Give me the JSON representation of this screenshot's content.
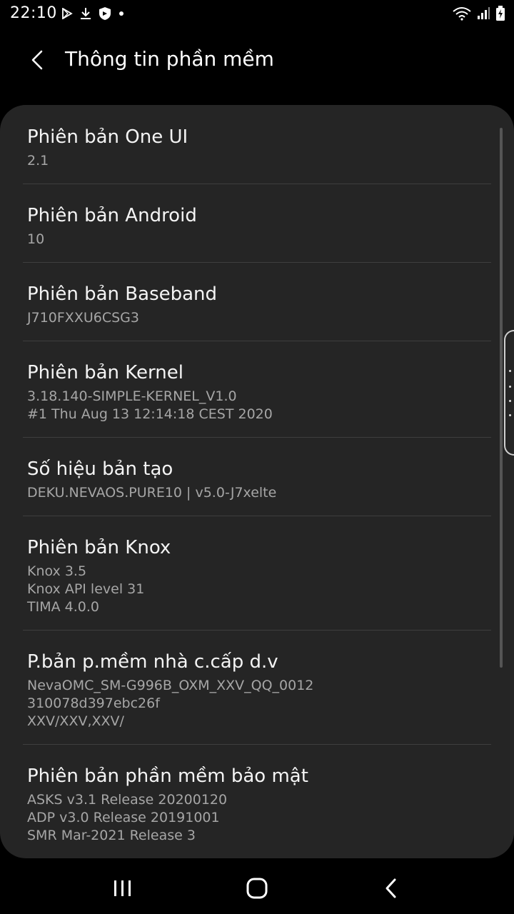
{
  "status_bar": {
    "time": "22:10",
    "left_icons": [
      "play-store-icon",
      "download-icon",
      "shield-icon",
      "dot-icon"
    ],
    "right_icons": [
      "wifi-icon",
      "signal-icon",
      "battery-charging-icon"
    ]
  },
  "header": {
    "title": "Thông tin phần mềm"
  },
  "items": [
    {
      "title": "Phiên bản One UI",
      "values": [
        "2.1"
      ]
    },
    {
      "title": "Phiên bản Android",
      "values": [
        "10"
      ]
    },
    {
      "title": "Phiên bản Baseband",
      "values": [
        "J710FXXU6CSG3"
      ]
    },
    {
      "title": "Phiên bản Kernel",
      "values": [
        "3.18.140-SIMPLE-KERNEL_V1.0",
        "#1 Thu Aug 13 12:14:18 CEST 2020"
      ]
    },
    {
      "title": "Số hiệu bản tạo",
      "values": [
        "DEKU.NEVAOS.PURE10 | v5.0-J7xelte"
      ]
    },
    {
      "title": "Phiên bản Knox",
      "values": [
        "Knox 3.5",
        "Knox API level 31",
        "TIMA 4.0.0"
      ]
    },
    {
      "title": "P.bản p.mềm nhà c.cấp d.v",
      "values": [
        "NevaOMC_SM-G996B_OXM_XXV_QQ_0012",
        "310078d397ebc26f",
        "XXV/XXV,XXV/"
      ]
    },
    {
      "title": "Phiên bản phần mềm bảo mật",
      "values": [
        "ASKS v3.1 Release 20200120",
        "ADP v3.0 Release 20191001",
        "SMR Mar-2021 Release 3"
      ]
    }
  ],
  "nav_bar": {
    "icons": [
      "recents-icon",
      "home-icon",
      "back-nav-icon"
    ]
  },
  "colors": {
    "background": "#000000",
    "card": "#252525",
    "title_text": "#f4f4f4",
    "value_text": "#a6a6a6",
    "divider": "#3e3e3e"
  }
}
